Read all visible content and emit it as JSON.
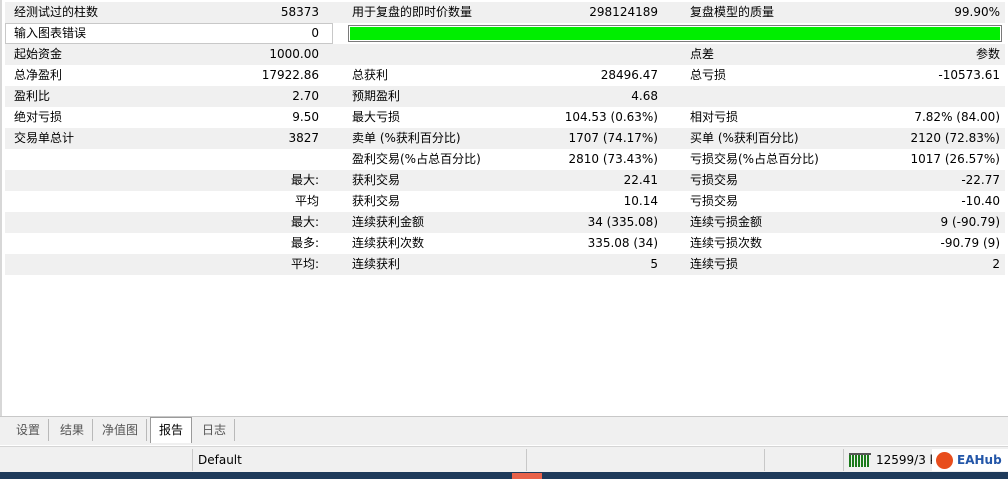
{
  "report": {
    "rows": [
      {
        "c1_label": "经测试过的柱数",
        "c1_value": "58373",
        "c2_label": "用于复盘的即时价数量",
        "c2_value": "298124189",
        "c3_label": "复盘模型的质量",
        "c3_value": "99.90%"
      },
      {
        "c1_label": "输入图表错误",
        "c1_value": "0"
      },
      {
        "c1_label": "起始资金",
        "c1_value": "1000.00",
        "c2_label": "",
        "c2_value": "",
        "c3_label": "点差",
        "c3_value": "参数"
      },
      {
        "c1_label": "总净盈利",
        "c1_value": "17922.86",
        "c2_label": "总获利",
        "c2_value": "28496.47",
        "c3_label": "总亏损",
        "c3_value": "-10573.61"
      },
      {
        "c1_label": "盈利比",
        "c1_value": "2.70",
        "c2_label": "预期盈利",
        "c2_value": "4.68",
        "c3_label": "",
        "c3_value": ""
      },
      {
        "c1_label": "绝对亏损",
        "c1_value": "9.50",
        "c2_label": "最大亏损",
        "c2_value": "104.53 (0.63%)",
        "c3_label": "相对亏损",
        "c3_value": "7.82% (84.00)"
      },
      {
        "c1_label": "交易单总计",
        "c1_value": "3827",
        "c2_label": "卖单 (%获利百分比)",
        "c2_value": "1707 (74.17%)",
        "c3_label": "买单 (%获利百分比)",
        "c3_value": "2120 (72.83%)"
      },
      {
        "c1_label": "",
        "c1_value": "",
        "c2_label": "盈利交易(%占总百分比)",
        "c2_value": "2810 (73.43%)",
        "c3_label": "亏损交易(%占总百分比)",
        "c3_value": "1017 (26.57%)"
      },
      {
        "c1_label": "",
        "c1_value": "最大:",
        "c2_label": "获利交易",
        "c2_value": "22.41",
        "c3_label": "亏损交易",
        "c3_value": "-22.77"
      },
      {
        "c1_label": "",
        "c1_value": "平均",
        "c2_label": "获利交易",
        "c2_value": "10.14",
        "c3_label": "亏损交易",
        "c3_value": "-10.40"
      },
      {
        "c1_label": "",
        "c1_value": "最大:",
        "c2_label": "连续获利金额",
        "c2_value": "34 (335.08)",
        "c3_label": "连续亏损金额",
        "c3_value": "9 (-90.79)"
      },
      {
        "c1_label": "",
        "c1_value": "最多:",
        "c2_label": "连续获利次数",
        "c2_value": "335.08 (34)",
        "c3_label": "连续亏损次数",
        "c3_value": "-90.79 (9)"
      },
      {
        "c1_label": "",
        "c1_value": "平均:",
        "c2_label": "连续获利",
        "c2_value": "5",
        "c3_label": "连续亏损",
        "c3_value": "2"
      }
    ],
    "model_quality_progress": 1.0,
    "progress_color": "#00ee00"
  },
  "tabs": [
    {
      "label": "设置",
      "active": false
    },
    {
      "label": "结果",
      "active": false
    },
    {
      "label": "净值图",
      "active": false
    },
    {
      "label": "报告",
      "active": true
    },
    {
      "label": "日志",
      "active": false
    }
  ],
  "statusbar": {
    "profile": "Default",
    "traffic": "12599/3 kb",
    "icon": "connection-bars-icon"
  },
  "watermark": {
    "text": "EAHub",
    "icon": "eahub-logo-icon"
  }
}
